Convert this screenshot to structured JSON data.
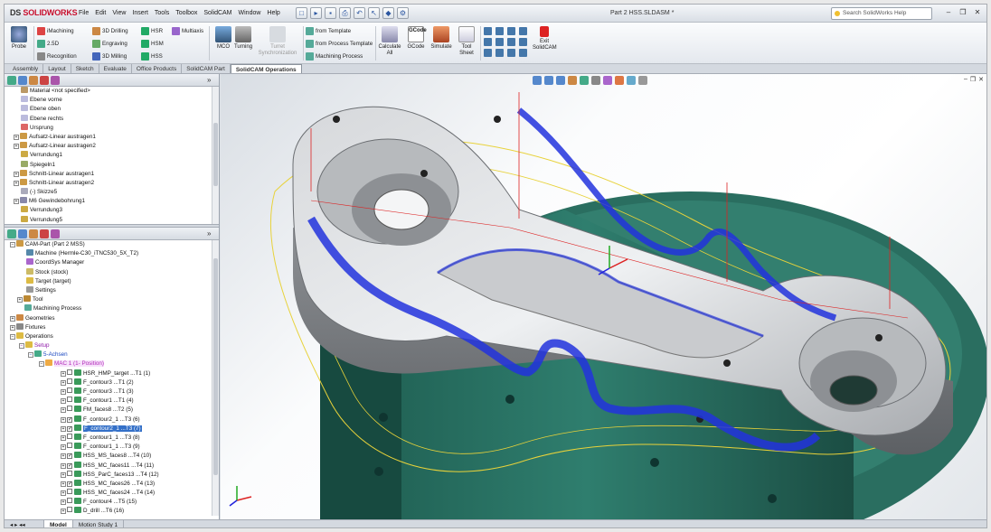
{
  "app": {
    "brand": "SOLIDWORKS",
    "brand_prefix": "DS",
    "doc_title": "Part 2 HSS.SLDASM *"
  },
  "menu": [
    "File",
    "Edit",
    "View",
    "Insert",
    "Tools",
    "Toolbox",
    "SolidCAM",
    "Window",
    "Help"
  ],
  "help_search": {
    "placeholder": "Search SolidWorks Help"
  },
  "ribbon": {
    "probe": "Probe",
    "col1": [
      "iMachining",
      "2.5D",
      "Recognition"
    ],
    "col2": [
      "3D Drilling",
      "Engraving",
      "3D Milling"
    ],
    "col3": [
      "HSR",
      "HSM",
      "HSS"
    ],
    "multiaxis": "Multiaxis",
    "mco": "MCO",
    "turning": "Turning",
    "turret": "Turret Synchronization",
    "templates": [
      "from Template",
      "from Process Template",
      "Machining Process"
    ],
    "calculate": "Calculate All",
    "gcode_top": "GCode",
    "gcode_label": "GCode",
    "simulate": "Simulate",
    "tool_sheet": "Tool Sheet",
    "exit": "Exit SolidCAM"
  },
  "command_tabs": [
    "Assembly",
    "Layout",
    "Sketch",
    "Evaluate",
    "Office Products",
    "SolidCAM Part",
    "SolidCAM Operations"
  ],
  "feature_tree": [
    "Material <not specified>",
    "Ebene vorne",
    "Ebene oben",
    "Ebene rechts",
    "Ursprung",
    "Aufsatz-Linear austragen1",
    "Aufsatz-Linear austragen2",
    "Verrundung1",
    "Spiegeln1",
    "Schnitt-Linear austragen1",
    "Schnitt-Linear austragen2",
    "(-) Skizze5",
    "M6 Gewindebohrung1",
    "Verrundung3",
    "Verrundung5"
  ],
  "cam_tree": {
    "root": "CAM-Part (Part 2 MSS)",
    "machine": "Machine (Hermle-C30_iTNC530_5X_T2)",
    "coord": "CoordSys Manager",
    "stock": "Stock (stock)",
    "target": "Target (target)",
    "settings": "Settings",
    "tool": "Tool",
    "machining_process": "Machining Process",
    "geometries": "Geometries",
    "fixtures": "Fixtures",
    "operations": "Operations",
    "setup": "Setup",
    "achsen": "5-Achsen",
    "mac": "MAC 1 (1- Position)",
    "ops": [
      {
        "label": "HSR_HMP_target ...T1 (1)",
        "checked": false
      },
      {
        "label": "F_contour3 ...T1 (2)",
        "checked": false
      },
      {
        "label": "F_contour3 ...T1 (3)",
        "checked": false
      },
      {
        "label": "F_contour1 ...T1 (4)",
        "checked": false
      },
      {
        "label": "FM_faces8 ...T2 (5)",
        "checked": false
      },
      {
        "label": "F_contour2_1 ...T3 (6)",
        "checked": true
      },
      {
        "label": "F_contour2_1 ...T3 (7)",
        "checked": true,
        "selected": true
      },
      {
        "label": "F_contour1_1 ...T3 (8)",
        "checked": false
      },
      {
        "label": "F_contour1_1 ...T3 (9)",
        "checked": false
      },
      {
        "label": "HSS_MS_faces8 ...T4 (10)",
        "checked": true
      },
      {
        "label": "HSS_MC_faces11 ...T4 (11)",
        "checked": true
      },
      {
        "label": "HSS_ParC_faces13 ...T4 (12)",
        "checked": false
      },
      {
        "label": "HSS_MC_faces26 ...T4 (13)",
        "checked": true
      },
      {
        "label": "HSS_MC_faces24 ...T4 (14)",
        "checked": false
      },
      {
        "label": "F_contour4 ...T5 (15)",
        "checked": false
      },
      {
        "label": "D_drill ...T6 (16)",
        "checked": false
      }
    ]
  },
  "bottom_tabs": [
    "Model",
    "Motion Study 1"
  ],
  "colors": {
    "toolpath": "#2233dd",
    "part": "#c9cbce",
    "fixture": "#2e7a6a",
    "selection": "#3470c8"
  }
}
